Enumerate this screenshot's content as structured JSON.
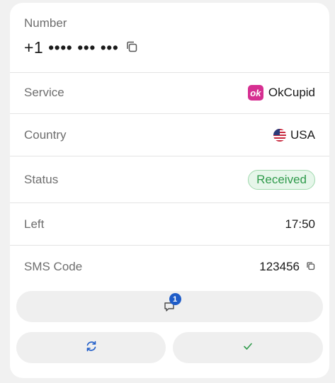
{
  "number": {
    "label": "Number",
    "value": "+1 •••• ••• •••"
  },
  "rows": {
    "service": {
      "label": "Service",
      "value": "OkCupid",
      "logo_text": "ok"
    },
    "country": {
      "label": "Country",
      "value": "USA"
    },
    "status": {
      "label": "Status",
      "value": "Received"
    },
    "left": {
      "label": "Left",
      "value": "17:50"
    },
    "sms_code": {
      "label": "SMS Code",
      "value": "123456"
    }
  },
  "messages_button": {
    "icon": "chat-icon",
    "count": "1"
  },
  "actions": {
    "refresh_icon": "refresh-icon",
    "confirm_icon": "check-icon"
  },
  "colors": {
    "status_green": "#2f9a4b",
    "status_bg": "#e6f6ea",
    "accent_blue": "#1e5cc8",
    "okcupid_pink": "#d62f91"
  }
}
